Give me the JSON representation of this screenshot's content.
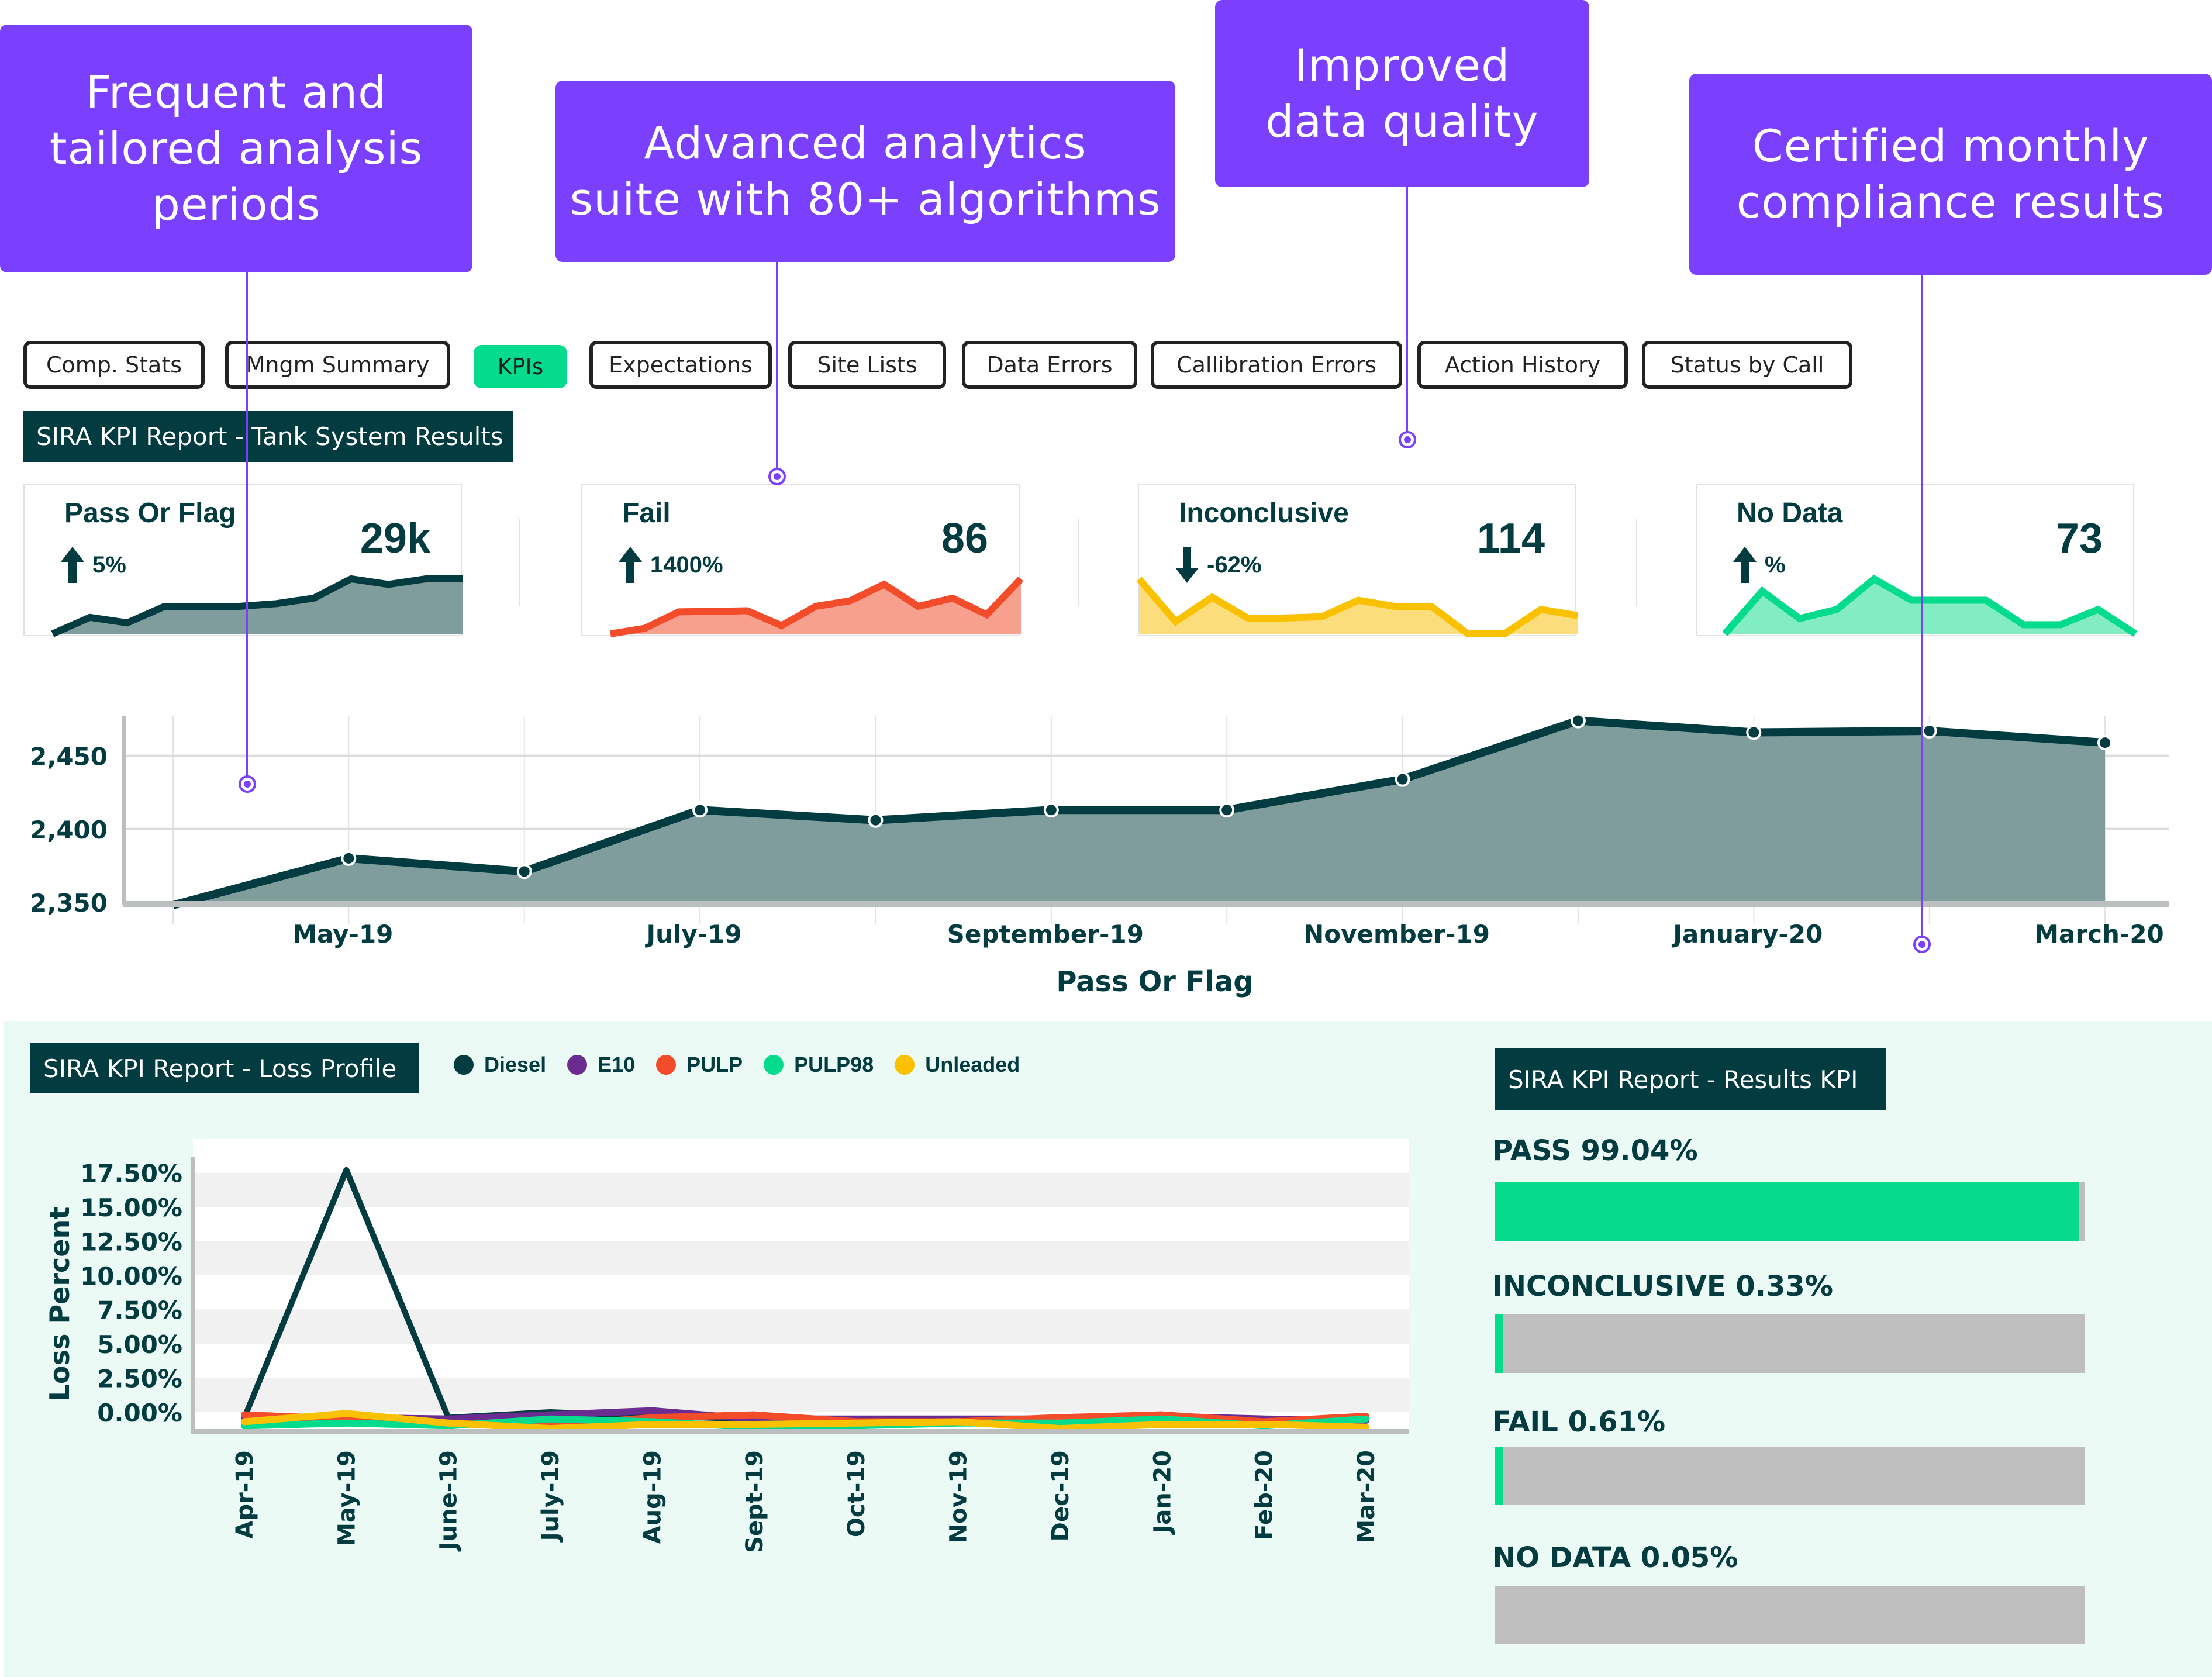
{
  "callouts": [
    {
      "text": "Frequent and tailored analysis periods",
      "lines": [
        "Frequent and",
        "tailored analysis",
        "periods"
      ]
    },
    {
      "text": "Advanced analytics suite with 80+ algorithms",
      "lines": [
        "Advanced analytics",
        "suite with 80+ algorithms"
      ]
    },
    {
      "text": "Improved data quality",
      "lines": [
        "Improved",
        "data quality"
      ]
    },
    {
      "text": "Certified monthly compliance results",
      "lines": [
        "Certified monthly",
        "compliance results"
      ]
    }
  ],
  "tabs": [
    {
      "label": "Comp. Stats",
      "active": false
    },
    {
      "label": "Mngm Summary",
      "active": false
    },
    {
      "label": "KPIs",
      "active": true
    },
    {
      "label": "Expectations",
      "active": false
    },
    {
      "label": "Site Lists",
      "active": false
    },
    {
      "label": "Data Errors",
      "active": false
    },
    {
      "label": "Callibration Errors",
      "active": false
    },
    {
      "label": "Action History",
      "active": false
    },
    {
      "label": "Status by Call",
      "active": false
    }
  ],
  "tank_section": {
    "title": "SIRA KPI Report - Tank System Results"
  },
  "kpis": [
    {
      "label": "Pass Or Flag",
      "value": "29k",
      "delta": "5%",
      "direction": "up",
      "color": "#023b40",
      "fill": "#809d9e",
      "spark": [
        0,
        3,
        2,
        5,
        5,
        5,
        5.5,
        6.5,
        10,
        9,
        10,
        10
      ]
    },
    {
      "label": "Fail",
      "value": "86",
      "delta": "1400%",
      "direction": "up",
      "color": "#f24c2a",
      "fill": "#f7a08e",
      "spark": [
        0,
        1,
        4,
        4.1,
        4.2,
        1.5,
        5,
        6,
        9,
        5,
        6.5,
        3.5,
        10
      ]
    },
    {
      "label": "Inconclusive",
      "value": "114",
      "delta": "-62%",
      "direction": "down",
      "color": "#f9c100",
      "fill": "#fbdd7c",
      "spark": [
        10,
        3,
        7,
        3.5,
        3.6,
        3.8,
        6.5,
        5.5,
        5.5,
        1,
        1,
        5,
        4
      ]
    },
    {
      "label": "No Data",
      "value": "73",
      "delta": "%",
      "direction": "up",
      "color": "#05db8c",
      "fill": "#82edc3",
      "spark": [
        0,
        7,
        2.5,
        4,
        9,
        5.5,
        5.5,
        5.5,
        1.5,
        1.5,
        4,
        0
      ]
    }
  ],
  "chart_data": [
    {
      "type": "area",
      "title": "",
      "xlabel": "Pass Or Flag",
      "ylabel": "",
      "x": [
        "Apr-19",
        "May-19",
        "Jun-19",
        "Jul-19",
        "Aug-19",
        "Sep-19",
        "Oct-19",
        "Nov-19",
        "Dec-19",
        "Jan-20",
        "Feb-20",
        "Mar-20"
      ],
      "values": [
        2348,
        2380,
        2371,
        2413,
        2406,
        2413,
        2413,
        2434,
        2474,
        2466,
        2467,
        2459
      ],
      "x_tick_labels": [
        "May-19",
        "July-19",
        "September-19",
        "November-19",
        "January-20",
        "March-20"
      ],
      "y_ticks": [
        2350,
        2400,
        2450
      ],
      "y_tick_labels": [
        "2,350",
        "2,400",
        "2,450"
      ],
      "ylim": [
        2348,
        2475
      ],
      "grid": true,
      "color": "#023b40",
      "fill": "#809d9e"
    },
    {
      "type": "line",
      "title": "SIRA KPI Report - Loss Profile",
      "xlabel": "",
      "ylabel": "Loss Percent",
      "categories": [
        "Apr-19",
        "May-19",
        "June-19",
        "July-19",
        "Aug-19",
        "Sept-19",
        "Oct-19",
        "Nov-19",
        "Dec-19",
        "Jan-20",
        "Feb-20",
        "Mar-20"
      ],
      "y_ticks": [
        0,
        2.5,
        5,
        7.5,
        10,
        12.5,
        15,
        17.5
      ],
      "y_tick_labels": [
        "0.00%",
        "2.50%",
        "5.00%",
        "7.50%",
        "10.00%",
        "12.50%",
        "15.00%",
        "17.50%"
      ],
      "ylim": [
        -1.2,
        20
      ],
      "legend_position": "top",
      "series": [
        {
          "name": "Diesel",
          "color": "#023b40",
          "values": [
            -0.4,
            17.7,
            -0.4,
            0.0,
            -0.3,
            -0.5,
            -0.5,
            -0.5,
            -0.5,
            -0.5,
            -0.5,
            -0.5
          ]
        },
        {
          "name": "E10",
          "color": "#6a2c91",
          "values": [
            -0.5,
            -0.4,
            -0.5,
            -0.2,
            0.1,
            -0.5,
            -0.5,
            -0.5,
            -0.5,
            -0.3,
            -0.5,
            -0.6
          ]
        },
        {
          "name": "PULP",
          "color": "#f24c2a",
          "values": [
            -0.2,
            -0.5,
            -0.8,
            -1.0,
            -0.4,
            -0.2,
            -0.7,
            -0.7,
            -0.4,
            -0.2,
            -0.7,
            -0.3
          ]
        },
        {
          "name": "PULP98",
          "color": "#05db8c",
          "values": [
            -1.0,
            -0.8,
            -1.0,
            -0.5,
            -0.7,
            -1.1,
            -1.0,
            -0.8,
            -0.8,
            -0.5,
            -1.0,
            -0.5
          ]
        },
        {
          "name": "Unleaded",
          "color": "#f9c100",
          "values": [
            -0.7,
            -0.1,
            -0.8,
            -1.2,
            -0.9,
            -0.9,
            -0.8,
            -0.7,
            -1.2,
            -0.9,
            -0.9,
            -1.1
          ]
        }
      ]
    }
  ],
  "loss_section": {
    "title": "SIRA KPI Report - Loss Profile"
  },
  "results_section": {
    "title": "SIRA KPI Report - Results KPI",
    "items": [
      {
        "label": "PASS 99.04%",
        "percent": 99.04
      },
      {
        "label": "INCONCLUSIVE 0.33%",
        "percent": 0.33
      },
      {
        "label": "FAIL 0.61%",
        "percent": 0.61
      },
      {
        "label": "NO DATA 0.05%",
        "percent": 0.05
      }
    ]
  }
}
